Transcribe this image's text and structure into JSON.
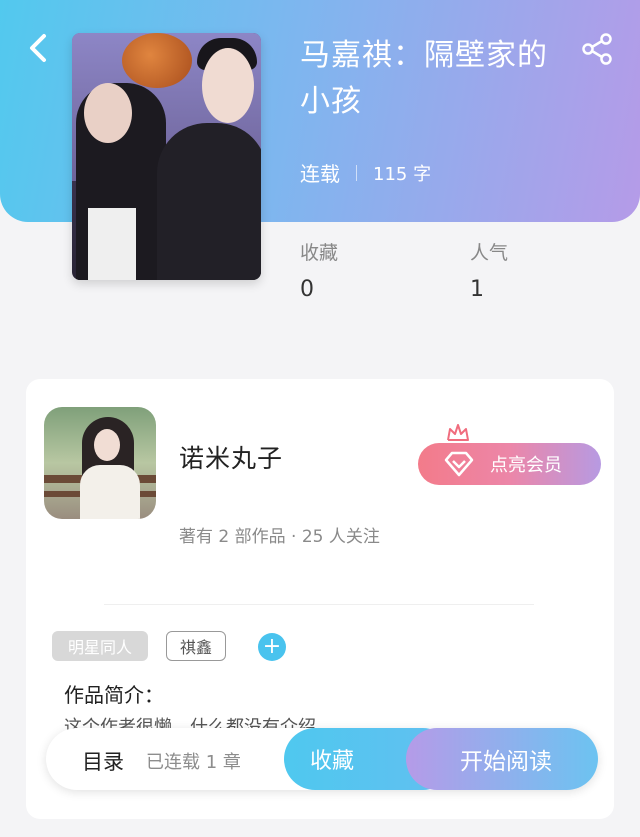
{
  "header": {
    "back_icon": "chevron-left-icon",
    "share_icon": "share-icon",
    "book_title": "马嘉祺：隔壁家的小孩",
    "status": "连载",
    "word_count": "115 字"
  },
  "stats": {
    "favorites_label": "收藏",
    "favorites_value": "0",
    "popularity_label": "人气",
    "popularity_value": "1"
  },
  "author": {
    "name": "诺米丸子",
    "info": "著有 2 部作品 · 25 人关注",
    "vip_button": "点亮会员"
  },
  "tags": [
    "明星同人",
    "祺鑫"
  ],
  "add_tag_symbol": "+",
  "intro": {
    "title": "作品简介：",
    "text": "这个作者很懒，什么都没有介绍"
  },
  "bottom_bar": {
    "toc_label": "目录",
    "chapters_label": "已连载 1 章",
    "favorite_button": "收藏",
    "read_button": "开始阅读"
  },
  "colors": {
    "accent_blue": "#49c3ee",
    "accent_purple": "#b59be8",
    "vip_pink": "#f37b8a"
  }
}
